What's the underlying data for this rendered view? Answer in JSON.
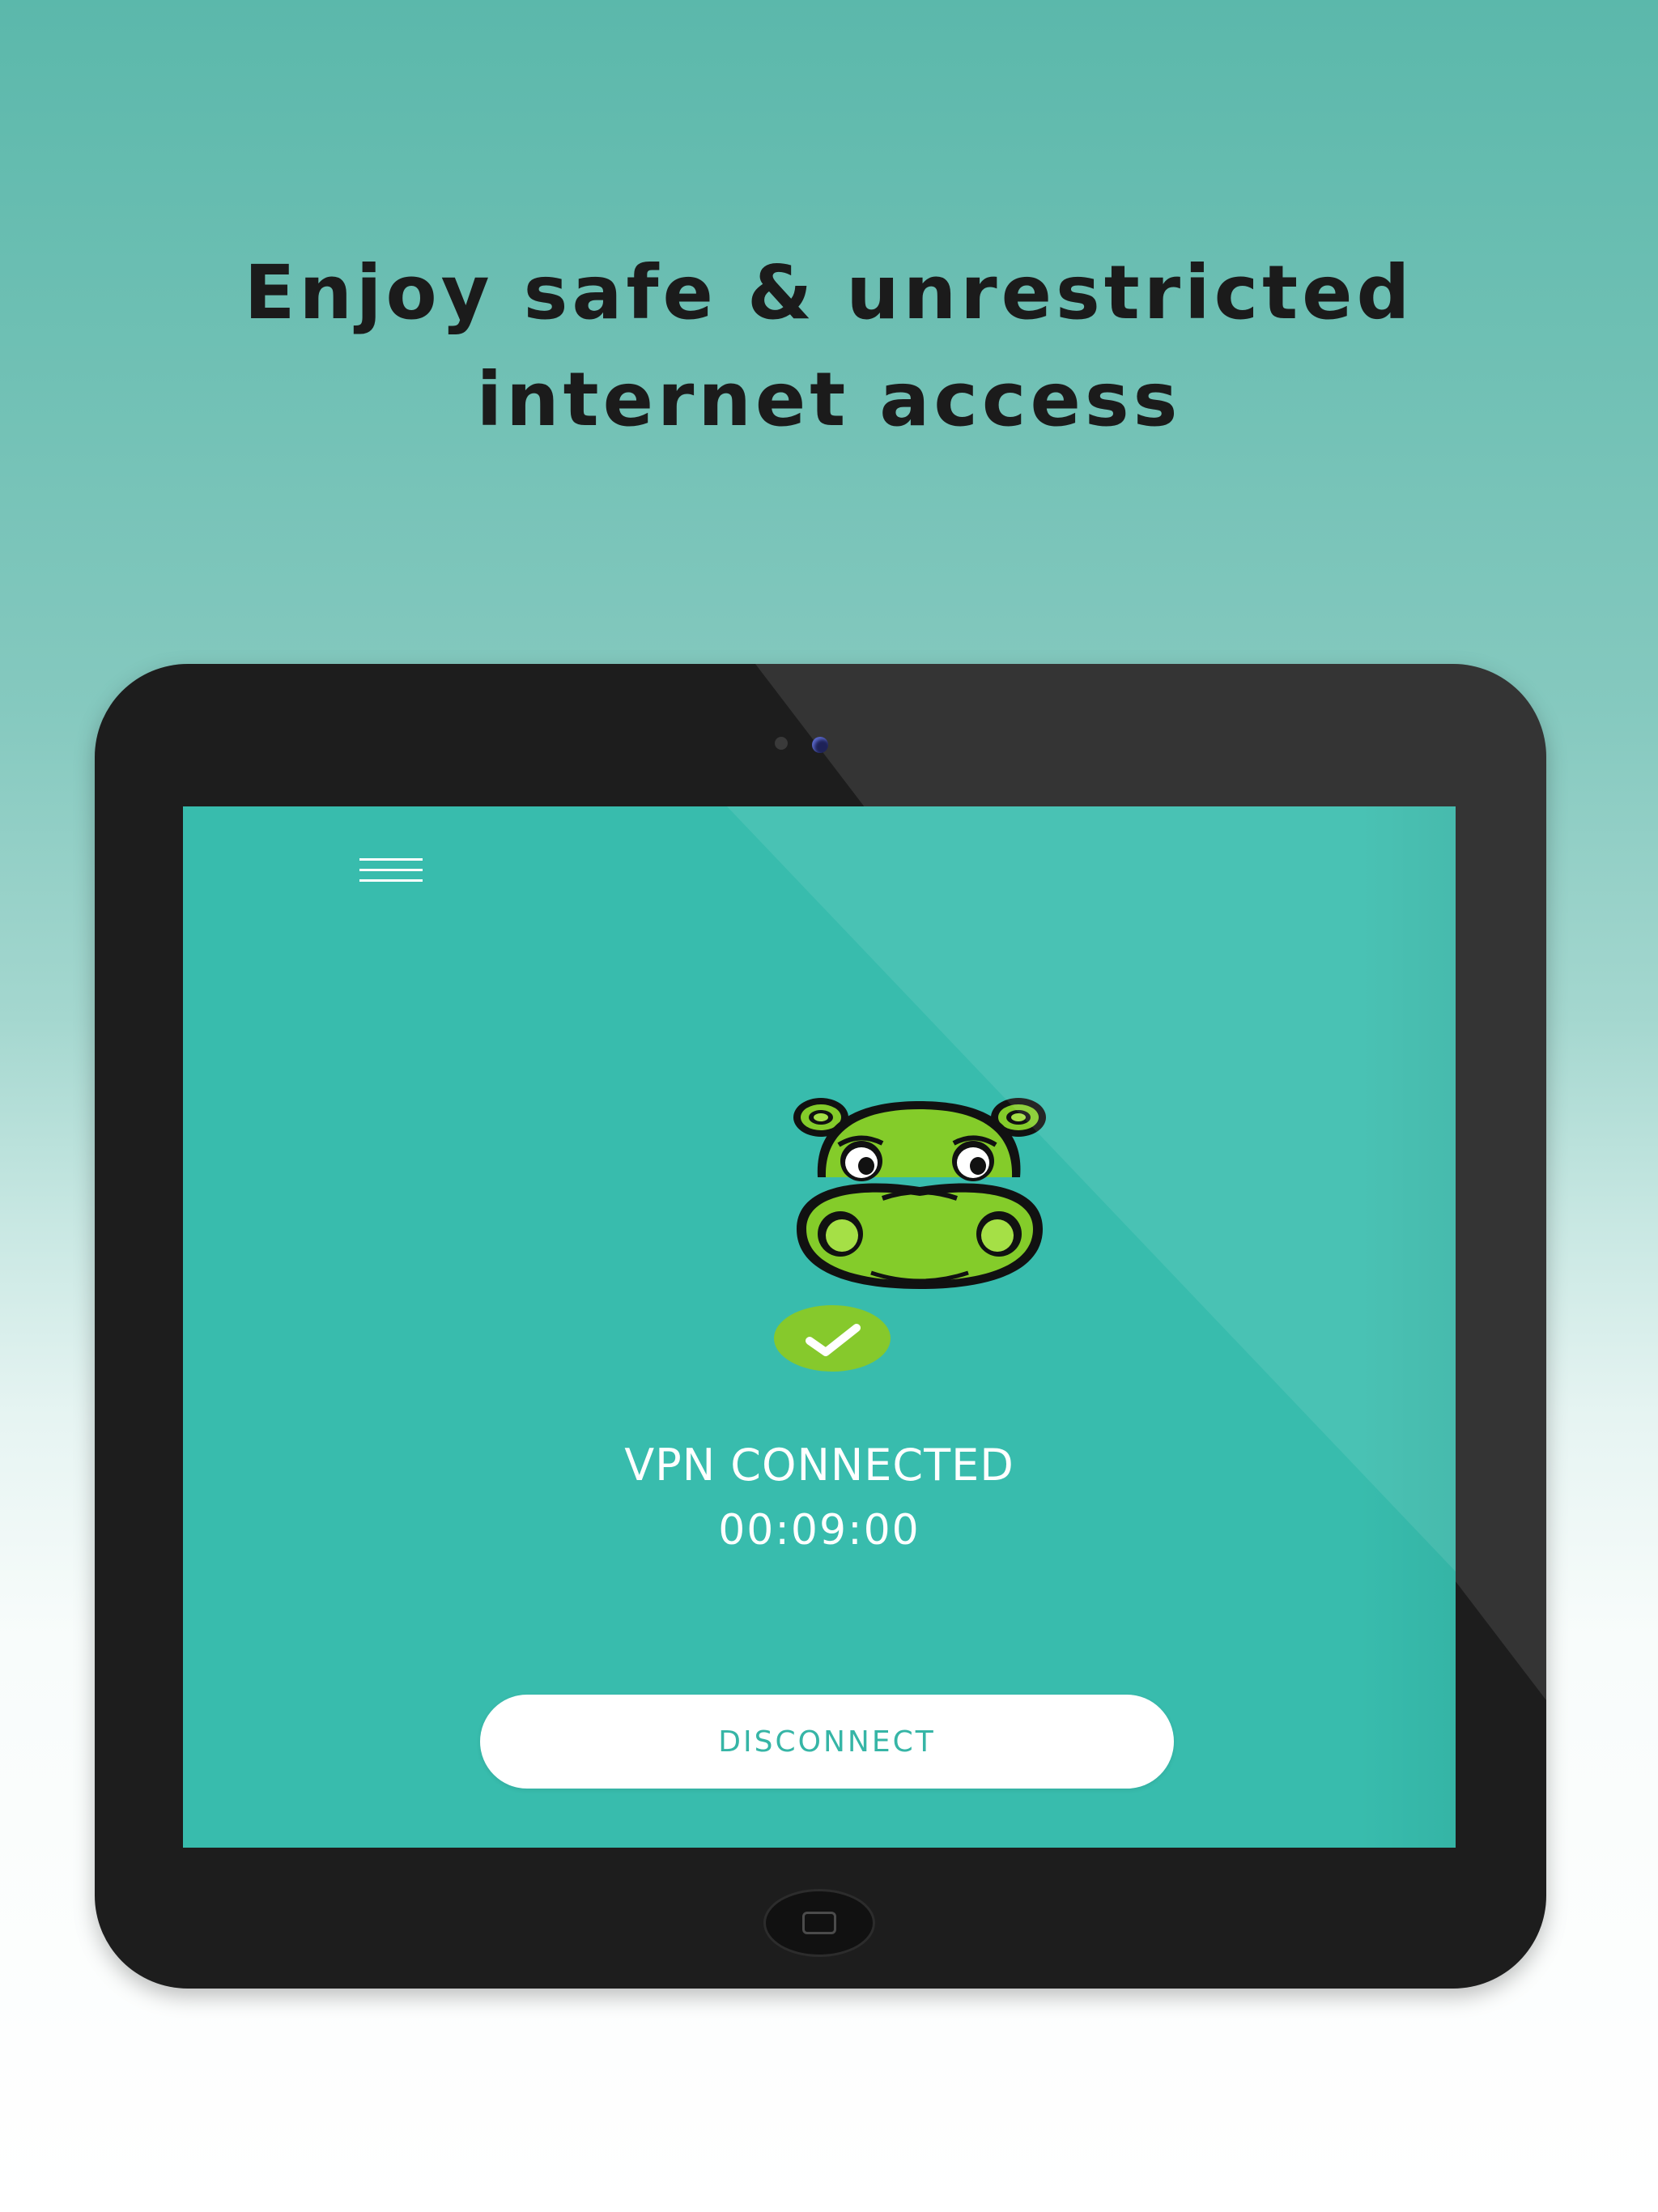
{
  "promo": {
    "headline_line1": "Enjoy safe & unrestricted",
    "headline_line2": "internet access"
  },
  "app": {
    "menu_icon": "hamburger-menu-icon",
    "logo_icon": "hippo-mascot-icon",
    "status_icon": "checkmark-icon",
    "status_text": "VPN CONNECTED",
    "timer": "00:09:00",
    "disconnect_label": "DISCONNECT"
  },
  "device": {
    "home_button_icon": "home-button-icon"
  },
  "colors": {
    "page_top": "#5bb8ab",
    "page_bottom": "#ffffff",
    "screen_background": "#38bcad",
    "tablet_frame": "#1d1d1d",
    "mascot_green": "#84cc2a",
    "check_badge": "#86c92c",
    "button_text": "#36b5a6",
    "headline_text": "#1b1b1b"
  }
}
